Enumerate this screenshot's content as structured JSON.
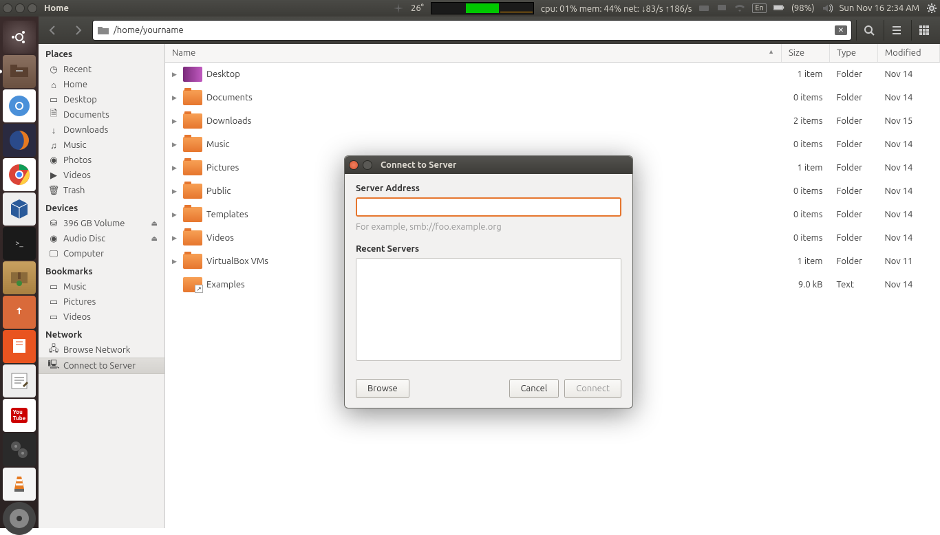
{
  "panel": {
    "app_title": "Home",
    "temp": "26°",
    "sys": "cpu: 01% mem: 44% net: ↓83/s ↑186/s",
    "lang": "En",
    "battery": "(98%)",
    "datetime": "Sun Nov 16  2:34 AM"
  },
  "toolbar": {
    "path": "/home/yourname"
  },
  "sidebar": {
    "places_hdr": "Places",
    "places": [
      {
        "label": "Recent",
        "icon": "clock"
      },
      {
        "label": "Home",
        "icon": "home"
      },
      {
        "label": "Desktop",
        "icon": "desktop"
      },
      {
        "label": "Documents",
        "icon": "doc"
      },
      {
        "label": "Downloads",
        "icon": "down"
      },
      {
        "label": "Music",
        "icon": "music"
      },
      {
        "label": "Photos",
        "icon": "photo"
      },
      {
        "label": "Videos",
        "icon": "video"
      },
      {
        "label": "Trash",
        "icon": "trash"
      }
    ],
    "devices_hdr": "Devices",
    "devices": [
      {
        "label": "396 GB Volume",
        "icon": "hdd",
        "eject": true
      },
      {
        "label": "Audio Disc",
        "icon": "disc",
        "eject": true
      },
      {
        "label": "Computer",
        "icon": "comp"
      }
    ],
    "bookmarks_hdr": "Bookmarks",
    "bookmarks": [
      {
        "label": "Music",
        "icon": "folder"
      },
      {
        "label": "Pictures",
        "icon": "folder"
      },
      {
        "label": "Videos",
        "icon": "folder"
      }
    ],
    "network_hdr": "Network",
    "network": [
      {
        "label": "Browse Network",
        "icon": "net"
      },
      {
        "label": "Connect to Server",
        "icon": "server",
        "sel": true
      }
    ]
  },
  "columns": {
    "name": "Name",
    "size": "Size",
    "type": "Type",
    "modified": "Modified"
  },
  "files": [
    {
      "name": "Desktop",
      "size": "1 item",
      "type": "Folder",
      "modified": "Nov 14",
      "icon": "desktop"
    },
    {
      "name": "Documents",
      "size": "0 items",
      "type": "Folder",
      "modified": "Nov 14",
      "icon": "folder"
    },
    {
      "name": "Downloads",
      "size": "2 items",
      "type": "Folder",
      "modified": "Nov 15",
      "icon": "folder"
    },
    {
      "name": "Music",
      "size": "0 items",
      "type": "Folder",
      "modified": "Nov 14",
      "icon": "folder"
    },
    {
      "name": "Pictures",
      "size": "1 item",
      "type": "Folder",
      "modified": "Nov 14",
      "icon": "folder"
    },
    {
      "name": "Public",
      "size": "0 items",
      "type": "Folder",
      "modified": "Nov 14",
      "icon": "folder"
    },
    {
      "name": "Templates",
      "size": "0 items",
      "type": "Folder",
      "modified": "Nov 14",
      "icon": "folder"
    },
    {
      "name": "Videos",
      "size": "0 items",
      "type": "Folder",
      "modified": "Nov 14",
      "icon": "folder"
    },
    {
      "name": "VirtualBox VMs",
      "size": "1 item",
      "type": "Folder",
      "modified": "Nov 11",
      "icon": "folder"
    },
    {
      "name": "Examples",
      "size": "9.0 kB",
      "type": "Text",
      "modified": "Nov 14",
      "icon": "link"
    }
  ],
  "dialog": {
    "title": "Connect to Server",
    "addr_label": "Server Address",
    "addr_value": "",
    "hint": "For example, smb://foo.example.org",
    "recent_label": "Recent Servers",
    "browse": "Browse",
    "cancel": "Cancel",
    "connect": "Connect"
  }
}
